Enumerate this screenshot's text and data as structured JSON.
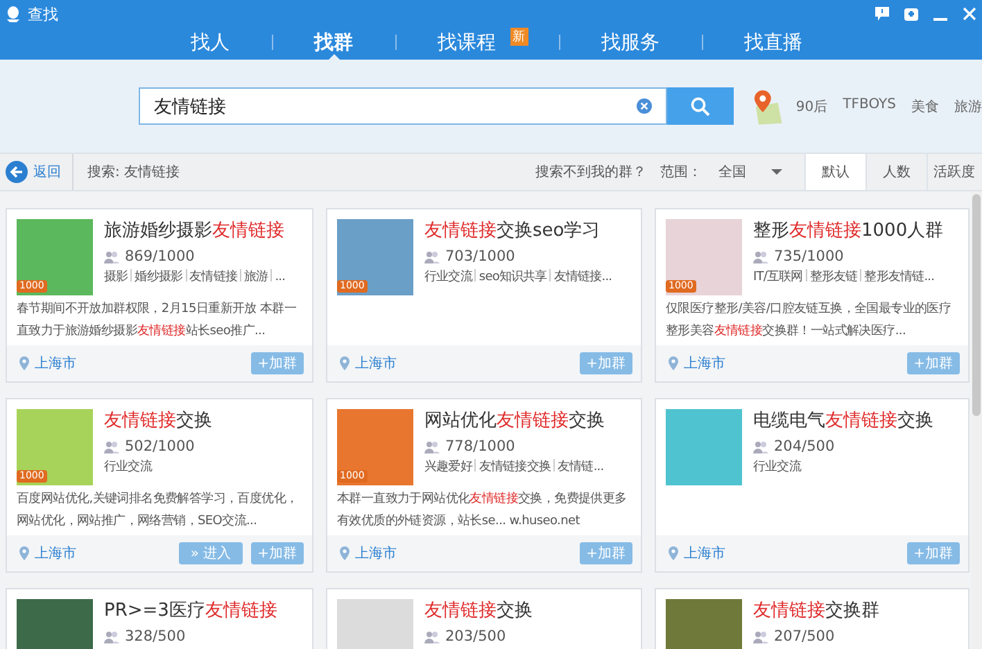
{
  "window": {
    "title": "查找"
  },
  "nav": [
    {
      "label": "找人",
      "selected": false
    },
    {
      "label": "找群",
      "selected": true
    },
    {
      "label": "找课程",
      "selected": false,
      "badge": "新"
    },
    {
      "label": "找服务",
      "selected": false
    },
    {
      "label": "找直播",
      "selected": false
    }
  ],
  "search": {
    "value": "友情链接"
  },
  "hot_tags": [
    "90后",
    "TFBOYS",
    "美食",
    "旅游"
  ],
  "filter_bar": {
    "back": "返回",
    "query": "搜索: 友情链接",
    "hint": "搜索不到我的群？",
    "range_label": "范围：",
    "range_value": "全国",
    "sorts": [
      {
        "label": "默认",
        "selected": true
      },
      {
        "label": "人数",
        "selected": false
      },
      {
        "label": "活跃度",
        "selected": false
      }
    ]
  },
  "cards": [
    {
      "badge": "1000",
      "title": [
        {
          "text": "旅游婚纱摄影",
          "highlight": false
        },
        {
          "text": "友情链接",
          "highlight": true
        }
      ],
      "members": "869/1000",
      "tags": [
        "摄影",
        "婚纱摄影",
        "友情链接",
        "旅游",
        "..."
      ],
      "description": [
        {
          "text": "春节期间不开放加群权限，2月15日重新开放 本群一直致力于旅游婚纱摄影",
          "highlight": false
        },
        {
          "text": "友情链接",
          "highlight": true
        },
        {
          "text": "站长seo推广...",
          "highlight": false
        }
      ],
      "location": "上海市",
      "buttons": [
        {
          "kind": "join",
          "label": "+加群"
        }
      ]
    },
    {
      "badge": "1000",
      "title": [
        {
          "text": "友情链接",
          "highlight": true
        },
        {
          "text": "交换seo学习",
          "highlight": false
        }
      ],
      "members": "703/1000",
      "tags": [
        "行业交流",
        "seo知识共享",
        "友情链接..."
      ],
      "location": "上海市",
      "buttons": [
        {
          "kind": "join",
          "label": "+加群"
        }
      ]
    },
    {
      "badge": "1000",
      "title": [
        {
          "text": "整形",
          "highlight": false
        },
        {
          "text": "友情链接",
          "highlight": true
        },
        {
          "text": "1000人群",
          "highlight": false
        }
      ],
      "members": "735/1000",
      "tags": [
        "IT/互联网",
        "整形友链",
        "整形友情链..."
      ],
      "description": [
        {
          "text": "仅限医疗整形/美容/口腔友链互换，全国最专业的医疗整形美容",
          "highlight": false
        },
        {
          "text": "友情链接",
          "highlight": true
        },
        {
          "text": "交换群！一站式解决医疗...",
          "highlight": false
        }
      ],
      "location": "上海市",
      "buttons": [
        {
          "kind": "join",
          "label": "+加群"
        }
      ]
    },
    {
      "badge": "1000",
      "title": [
        {
          "text": "友情链接",
          "highlight": true
        },
        {
          "text": "交换",
          "highlight": false
        }
      ],
      "members": "502/1000",
      "tags": [
        "行业交流"
      ],
      "description": [
        {
          "text": "百度网站优化,关键词排名免费解答学习，百度优化，网站优化，网站推广，网络营销，SEO交流...",
          "highlight": false
        }
      ],
      "location": "上海市",
      "buttons": [
        {
          "kind": "enter",
          "label": "» 进入"
        },
        {
          "kind": "join",
          "label": "+加群"
        }
      ]
    },
    {
      "badge": "1000",
      "title": [
        {
          "text": "网站优化",
          "highlight": false
        },
        {
          "text": "友情链接",
          "highlight": true
        },
        {
          "text": "交换",
          "highlight": false
        }
      ],
      "members": "778/1000",
      "tags": [
        "兴趣爱好",
        "友情链接交换",
        "友情链..."
      ],
      "description": [
        {
          "text": "本群一直致力于网站优化",
          "highlight": false
        },
        {
          "text": "友情链接",
          "highlight": true
        },
        {
          "text": "交换，免费提供更多有效优质的外链资源，站长se... w.huseo.net",
          "highlight": false
        }
      ],
      "location": "上海市",
      "buttons": [
        {
          "kind": "join",
          "label": "+加群"
        }
      ]
    },
    {
      "title": [
        {
          "text": "电缆电气",
          "highlight": false
        },
        {
          "text": "友情链接",
          "highlight": true
        },
        {
          "text": "交换",
          "highlight": false
        }
      ],
      "members": "204/500",
      "tags": [
        "行业交流"
      ],
      "location": "上海市",
      "buttons": [
        {
          "kind": "join",
          "label": "+加群"
        }
      ]
    },
    {
      "title": [
        {
          "text": "PR>=3医疗",
          "highlight": false
        },
        {
          "text": "友情链接",
          "highlight": true
        }
      ],
      "members": "328/500"
    },
    {
      "title": [
        {
          "text": "友情链接",
          "highlight": true
        },
        {
          "text": "交换",
          "highlight": false
        }
      ],
      "members": "203/500"
    },
    {
      "title": [
        {
          "text": "友情链接",
          "highlight": true
        },
        {
          "text": "交换群",
          "highlight": false
        }
      ],
      "members": "207/500"
    }
  ]
}
